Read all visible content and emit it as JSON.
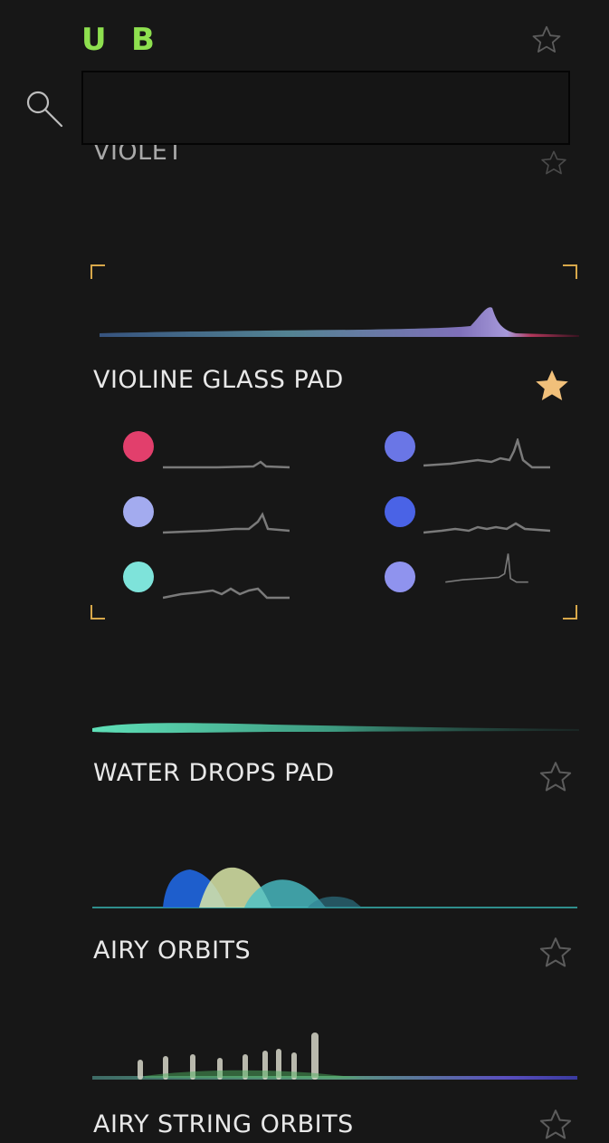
{
  "header": {
    "user_label": "U",
    "bank_label": "B"
  },
  "search": {
    "placeholder": "",
    "value": ""
  },
  "presets": [
    {
      "name": "VIOLET",
      "favorite": false,
      "state": "partially-hidden-under-search"
    },
    {
      "name": "VIOLINE GLASS PAD",
      "favorite": true,
      "state": "selected"
    },
    {
      "name": "WATER DROPS PAD",
      "favorite": false
    },
    {
      "name": "AIRY ORBITS",
      "favorite": false
    },
    {
      "name": "AIRY STRING ORBITS",
      "favorite": false,
      "state": "partially-cut-off-at-bottom"
    }
  ],
  "macros": [
    {
      "color": "#e23f6c",
      "shape": "small-peak-end"
    },
    {
      "color": "#6a76e6",
      "shape": "peak-end"
    },
    {
      "color": "#a3abef",
      "shape": "peak-late"
    },
    {
      "color": "#4a63e6",
      "shape": "wavy"
    },
    {
      "color": "#7ee3da",
      "shape": "wavy-bumps"
    },
    {
      "color": "#8f93ee",
      "shape": "tall-peak-end"
    }
  ],
  "colors": {
    "background": "#171717",
    "accent_green": "#8ee04f",
    "favorite_gold": "#f1c07a",
    "star_outline": "#5c5c5c",
    "bracket_gold": "#d8a84a"
  }
}
